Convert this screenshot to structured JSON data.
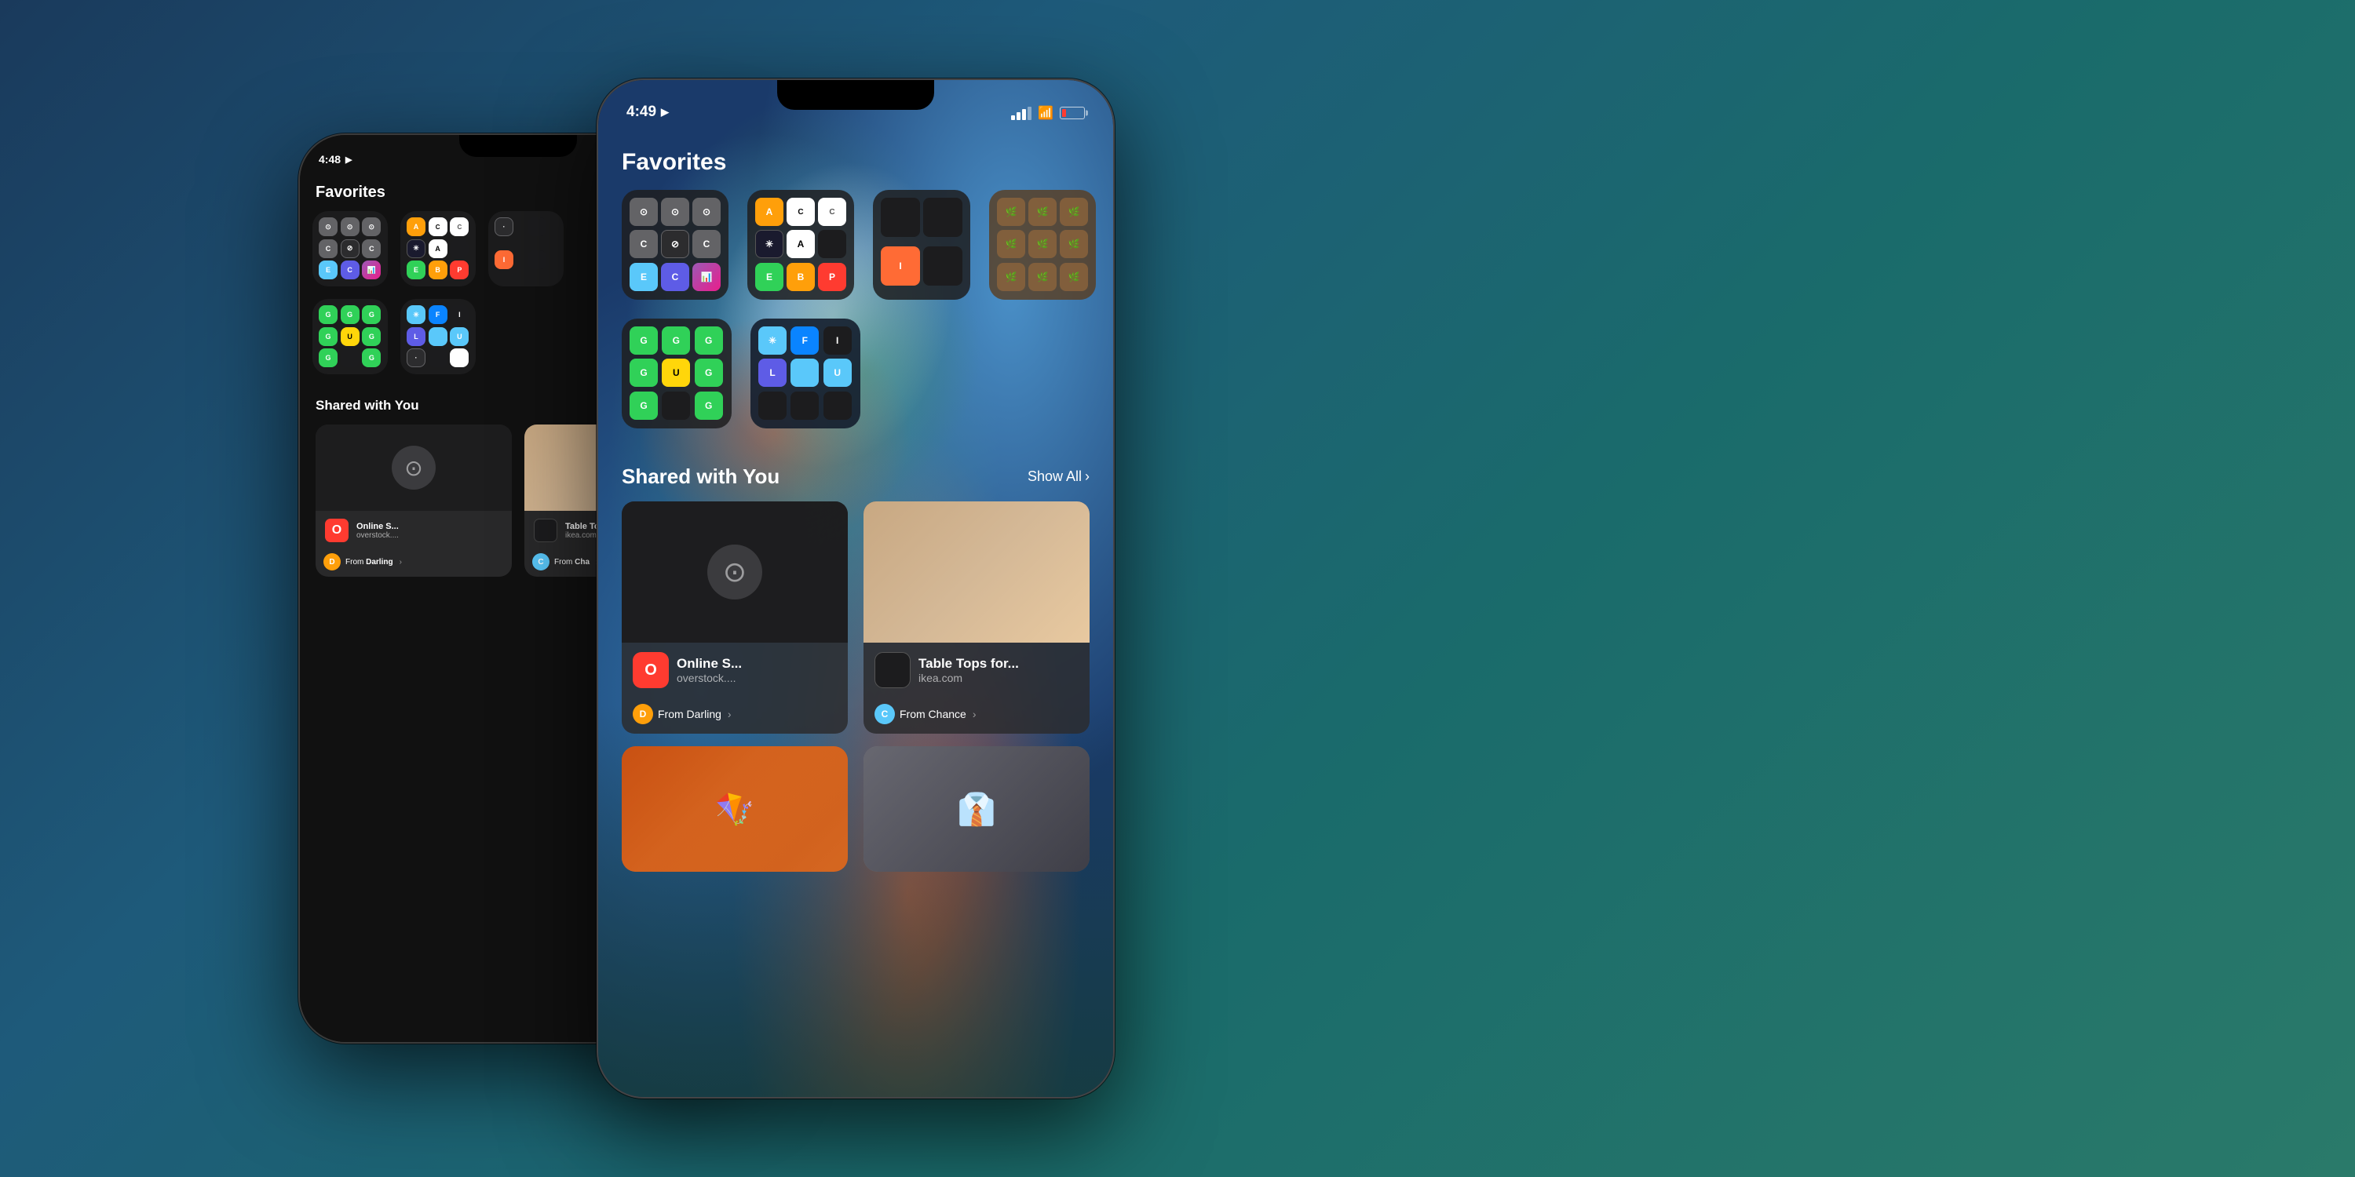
{
  "background": {
    "gradient": "linear-gradient(135deg, #1a3a5c, #1e5a7a, #1a6b6b, #2a7a6a)"
  },
  "phone_back": {
    "time": "4:48",
    "has_location": true,
    "favorites_title": "Favorites",
    "folders": [
      {
        "id": "folder1",
        "apps": [
          {
            "color": "gray",
            "label": ""
          },
          {
            "color": "gray",
            "label": ""
          },
          {
            "color": "gray",
            "label": ""
          },
          {
            "color": "gray",
            "label": "C"
          },
          {
            "color": "circle",
            "label": ""
          },
          {
            "color": "gray",
            "label": "C"
          },
          {
            "color": "teal",
            "label": "E"
          },
          {
            "color": "purple",
            "label": "C"
          },
          {
            "color": "purple",
            "label": ""
          }
        ]
      },
      {
        "id": "folder2",
        "apps": [
          {
            "color": "orange",
            "label": "A"
          },
          {
            "color": "white",
            "label": ""
          },
          {
            "color": "white",
            "label": "C"
          },
          {
            "color": "green",
            "label": "*"
          },
          {
            "color": "white",
            "label": "A"
          },
          {
            "color": ""
          },
          {
            "color": "green",
            "label": "E"
          },
          {
            "color": "orange",
            "label": "B"
          },
          {
            "color": "red",
            "label": "P"
          }
        ]
      },
      {
        "id": "folder3",
        "apps": [
          {
            "color": "circle",
            "label": ""
          },
          {
            "color": "dark",
            "label": ""
          },
          {
            "color": ""
          },
          {
            "color": "dark",
            "label": ""
          },
          {
            "color": "orange",
            "label": ""
          },
          {
            "color": "dark",
            "label": ""
          }
        ]
      }
    ],
    "folders_row2": [
      {
        "id": "folder4",
        "apps": [
          {
            "color": "green",
            "label": "G"
          },
          {
            "color": "green",
            "label": "G"
          },
          {
            "color": "green",
            "label": "G"
          },
          {
            "color": "green",
            "label": "G"
          },
          {
            "color": "yellow",
            "label": "U"
          },
          {
            "color": "green",
            "label": "G"
          },
          {
            "color": "green",
            "label": "G"
          },
          {
            "color": "dark",
            "label": ""
          },
          {
            "color": "green",
            "label": "G"
          }
        ]
      },
      {
        "id": "folder5",
        "apps": [
          {
            "color": "teal",
            "label": "*"
          },
          {
            "color": "blue",
            "label": "F"
          },
          {
            "color": "dark",
            "label": "I"
          },
          {
            "color": "purple",
            "label": "L"
          },
          {
            "color": "teal",
            "label": ""
          },
          {
            "color": "teal",
            "label": "U"
          },
          {
            "color": "circle",
            "label": ""
          },
          {
            "color": "dark",
            "label": ""
          },
          {
            "color": "white",
            "label": ""
          }
        ]
      }
    ],
    "shared_with_you_title": "Shared with You",
    "cards": [
      {
        "id": "card1",
        "preview_type": "dark",
        "app_color": "red",
        "app_label": "O",
        "name": "Online S...",
        "domain": "overstock....",
        "sender": "Darling",
        "sender_color": "#ff9f0a",
        "sender_initial": "D"
      },
      {
        "id": "card2",
        "preview_type": "warm",
        "app_color": "dark",
        "app_label": "",
        "name": "Table Top",
        "domain": "ikea.com",
        "sender": "Cha",
        "sender_color": "#5ac8fa",
        "sender_initial": "C"
      }
    ]
  },
  "phone_front": {
    "time": "4:49",
    "has_location": true,
    "favorites_title": "Favorites",
    "folders": [
      {
        "id": "ff1",
        "apps": [
          {
            "color": "gray",
            "label": ""
          },
          {
            "color": "gray",
            "label": ""
          },
          {
            "color": "gray",
            "label": ""
          },
          {
            "color": "gray",
            "label": "C"
          },
          {
            "color": "circle",
            "label": ""
          },
          {
            "color": "gray",
            "label": "C"
          },
          {
            "color": "teal",
            "label": "E"
          },
          {
            "color": "purple",
            "label": "C"
          },
          {
            "color": "purple",
            "label": ""
          }
        ]
      },
      {
        "id": "ff2",
        "apps": [
          {
            "color": "orange",
            "label": "A"
          },
          {
            "color": "white",
            "label": ""
          },
          {
            "color": "white",
            "label": "C"
          },
          {
            "color": "green",
            "label": "*"
          },
          {
            "color": "white",
            "label": "A"
          },
          {
            "color": ""
          },
          {
            "color": "green",
            "label": "E"
          },
          {
            "color": "orange",
            "label": "B"
          },
          {
            "color": "red",
            "label": "P"
          }
        ]
      },
      {
        "id": "ff3",
        "apps": [
          {
            "color": "dark",
            "label": ""
          },
          {
            "color": "dark",
            "label": ""
          },
          {
            "color": "dark",
            "label": ""
          },
          {
            "color": "dark",
            "label": ""
          },
          {
            "color": "orange",
            "label": ""
          },
          {
            "color": "dark",
            "label": ""
          }
        ]
      },
      {
        "id": "ff4",
        "apps": [
          {
            "color": "brown",
            "label": ""
          },
          {
            "color": "brown",
            "label": ""
          },
          {
            "color": "brown",
            "label": ""
          },
          {
            "color": "brown",
            "label": ""
          },
          {
            "color": "brown",
            "label": ""
          },
          {
            "color": "brown",
            "label": ""
          }
        ]
      }
    ],
    "folders_row2": [
      {
        "id": "ff5",
        "apps": [
          {
            "color": "green",
            "label": "G"
          },
          {
            "color": "green",
            "label": "G"
          },
          {
            "color": "green",
            "label": "G"
          },
          {
            "color": "green",
            "label": "G"
          },
          {
            "color": "yellow",
            "label": "U"
          },
          {
            "color": "green",
            "label": "G"
          },
          {
            "color": "green",
            "label": "G"
          },
          {
            "color": "dark",
            "label": ""
          },
          {
            "color": "green",
            "label": "G"
          }
        ]
      },
      {
        "id": "ff6",
        "apps": [
          {
            "color": "teal",
            "label": "*"
          },
          {
            "color": "blue",
            "label": "F"
          },
          {
            "color": "dark",
            "label": "I"
          },
          {
            "color": "purple",
            "label": "L"
          },
          {
            "color": "teal",
            "label": ""
          },
          {
            "color": "teal",
            "label": "U"
          },
          {
            "color": "dark",
            "label": ""
          },
          {
            "color": "dark",
            "label": ""
          },
          {
            "color": "dark",
            "label": ""
          }
        ]
      }
    ],
    "shared_with_you_title": "Shared with You",
    "show_all_label": "Show All",
    "cards": [
      {
        "id": "fc1",
        "preview_type": "dark",
        "app_color": "red",
        "app_label": "O",
        "name": "Online S...",
        "domain": "overstock....",
        "sender": "From Darling",
        "sender_color": "#ff9f0a",
        "sender_initial": "D"
      },
      {
        "id": "fc2",
        "preview_type": "warm",
        "app_color": "dark",
        "app_label": "",
        "name": "Table Tops for...",
        "domain": "ikea.com",
        "sender": "From Chance",
        "sender_color": "#5ac8fa",
        "sender_initial": "C"
      }
    ],
    "bottom_cards": [
      {
        "id": "bc1",
        "type": "kite",
        "label": ""
      },
      {
        "id": "bc2",
        "type": "outfit",
        "label": ""
      }
    ]
  }
}
